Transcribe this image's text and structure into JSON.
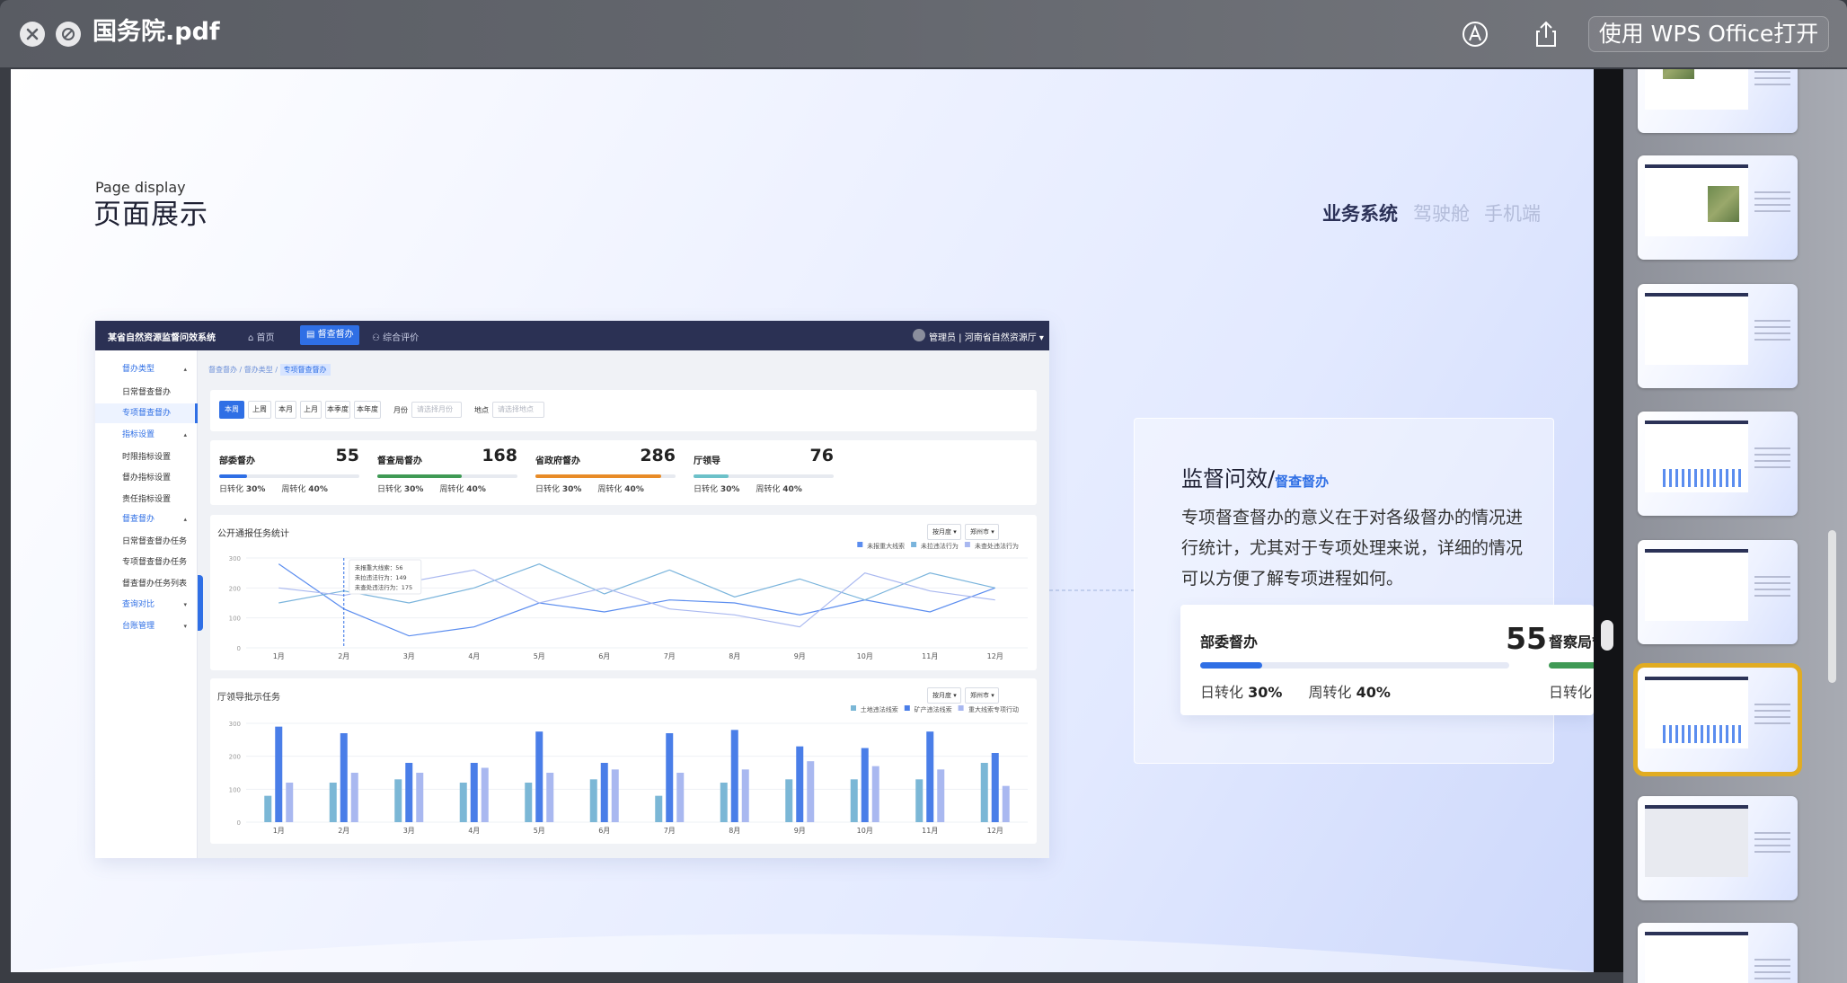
{
  "window": {
    "title": "国务院.pdf",
    "open_with": "使用 WPS Office打开"
  },
  "slide": {
    "label_en": "Page display",
    "label_cn": "页面展示",
    "nav": [
      "业务系统",
      "驾驶舱",
      "手机端"
    ],
    "app": {
      "system_title": "某省自然资源监督问效系统",
      "top_nav": [
        "首页",
        "督查督办",
        "综合评价"
      ],
      "user": "管理员 | 河南省自然资源厅",
      "sidebar": [
        "督办类型",
        "日常督查督办",
        "专项督查督办",
        "指标设置",
        "时限指标设置",
        "督办指标设置",
        "责任指标设置",
        "督查督办",
        "日常督查督办任务",
        "专项督查督办任务",
        "督查督办任务列表",
        "查询对比",
        "台账管理"
      ],
      "breadcrumb": [
        "督查督办",
        "督办类型",
        "专项督查督办"
      ],
      "filters": {
        "ranges": [
          "本周",
          "上周",
          "本月",
          "上月",
          "本季度",
          "本年度"
        ],
        "month_label": "月份",
        "month_placeholder": "请选择月份",
        "place_label": "地点",
        "place_placeholder": "请选择地点"
      },
      "kpis": [
        {
          "title": "部委督办",
          "value": "55",
          "r1_label": "日转化",
          "r1": "30%",
          "r2_label": "周转化",
          "r2": "40%",
          "progress": 0.2,
          "color": "#2f6fe5"
        },
        {
          "title": "督查局督办",
          "value": "168",
          "r1_label": "日转化",
          "r1": "30%",
          "r2_label": "周转化",
          "r2": "40%",
          "progress": 0.6,
          "color": "#3f9a55"
        },
        {
          "title": "省政府督办",
          "value": "286",
          "r1_label": "日转化",
          "r1": "30%",
          "r2_label": "周转化",
          "r2": "40%",
          "progress": 0.9,
          "color": "#e88b27"
        },
        {
          "title": "厅领导",
          "value": "76",
          "r1_label": "日转化",
          "r1": "30%",
          "r2_label": "周转化",
          "r2": "40%",
          "progress": 0.25,
          "color": "#6cc1c9"
        }
      ],
      "selectors": [
        "按月度",
        "郑州市"
      ],
      "line_chart_title": "公开通报任务统计",
      "bar_chart_title": "厅领导批示任务",
      "tooltip": [
        "未报重大线索：56",
        "未拉违法行为：149",
        "未查处违法行为：175"
      ]
    },
    "right_card": {
      "title": "监督问效/",
      "subtitle": "督查督办",
      "desc": "专项督查督办的意义在于对各级督办的情况进行统计，尤其对于专项处理来说，详细的情况可以方便了解专项进程如何。",
      "kpi": {
        "title": "部委督办",
        "value": "55",
        "r1_label": "日转化",
        "r1": "30%",
        "r2_label": "周转化",
        "r2": "40%",
        "progress": 0.2
      },
      "kpi2_title": "督察局督",
      "kpi2_r1_label": "日转化"
    }
  },
  "chart_data": [
    {
      "type": "line",
      "title": "公开通报任务统计",
      "categories": [
        "1月",
        "2月",
        "3月",
        "4月",
        "5月",
        "6月",
        "7月",
        "8月",
        "9月",
        "10月",
        "11月",
        "12月"
      ],
      "ylim": [
        0,
        300
      ],
      "yticks": [
        0,
        100,
        200,
        300
      ],
      "series": [
        {
          "name": "未报重大线索",
          "color": "#5b8def",
          "values": [
            280,
            130,
            40,
            70,
            150,
            120,
            160,
            150,
            110,
            160,
            120,
            200
          ]
        },
        {
          "name": "未拉违法行为",
          "color": "#7ab4dc",
          "values": [
            150,
            190,
            150,
            200,
            280,
            180,
            260,
            170,
            230,
            160,
            250,
            200
          ]
        },
        {
          "name": "未查处违法行为",
          "color": "#a9b8f0",
          "values": [
            200,
            175,
            220,
            260,
            150,
            200,
            130,
            110,
            70,
            250,
            190,
            160
          ]
        }
      ]
    },
    {
      "type": "bar",
      "title": "厅领导批示任务",
      "categories": [
        "1月",
        "2月",
        "3月",
        "4月",
        "5月",
        "6月",
        "7月",
        "8月",
        "9月",
        "10月",
        "11月",
        "12月"
      ],
      "ylim": [
        0,
        300
      ],
      "yticks": [
        0,
        100,
        200,
        300
      ],
      "series": [
        {
          "name": "土地违法线索",
          "color": "#7bb7d6",
          "values": [
            80,
            120,
            130,
            120,
            120,
            130,
            80,
            120,
            130,
            130,
            130,
            180
          ]
        },
        {
          "name": "矿产违法线索",
          "color": "#4a7ee8",
          "values": [
            290,
            270,
            180,
            180,
            275,
            180,
            270,
            280,
            230,
            225,
            275,
            210
          ]
        },
        {
          "name": "重大线索专项行动",
          "color": "#a9b8f0",
          "values": [
            120,
            150,
            150,
            165,
            150,
            160,
            150,
            160,
            185,
            170,
            160,
            110
          ]
        }
      ]
    }
  ]
}
